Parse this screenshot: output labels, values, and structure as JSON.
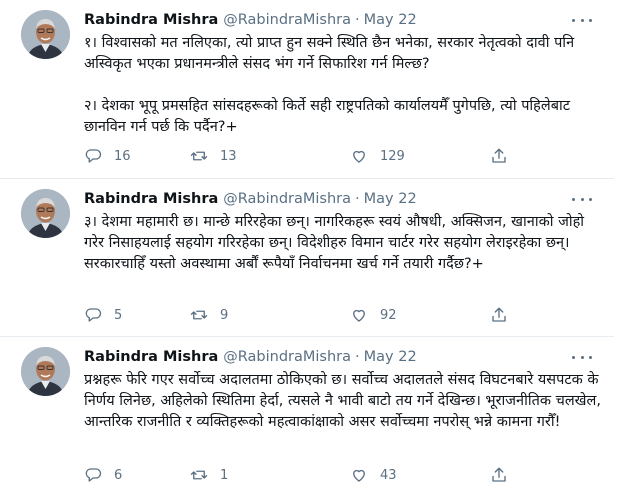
{
  "tweets": [
    {
      "author": "Rabindra Mishra",
      "handle": "@RabindraMishra",
      "separator": "·",
      "date": "May 22",
      "text": "१। विश्वासको मत नलिएका, त्यो प्राप्त हुन सक्ने स्थिति छैन भनेका, सरकार नेतृत्वको दावी पनि अस्विकृत भएका प्रधानमन्त्रीले संसद भंग गर्ने सिफारिश गर्न मिल्छ?\n\n२। देशका भूपू प्रमसहित सांसदहरूको किर्ते सही राष्ट्रपतिको कार्यालयमैँ पुगेपछि, त्यो पहिलेबाट छानविन गर्न पर्छ कि पर्दैन?+",
      "replies": "16",
      "retweets": "13",
      "likes": "129"
    },
    {
      "author": "Rabindra Mishra",
      "handle": "@RabindraMishra",
      "separator": "·",
      "date": "May 22",
      "text": "३। देशमा महामारी छ। मान्छे मरिरहेका छन्। नागरिकहरू स्वयं औषधी, अक्सिजन, खानाको जोहो गरेर निसाहयलाई सहयोग गरिरहेका छन्। विदेशीहरु विमान चार्टर गरेर सहयोग लेराइरहेका छन्। सरकारचाहिँ यस्तो अवस्थामा अर्बौं रूपैयाँ निर्वाचनमा खर्च गर्ने तयारी गर्दैछ?+",
      "replies": "5",
      "retweets": "9",
      "likes": "92"
    },
    {
      "author": "Rabindra Mishra",
      "handle": "@RabindraMishra",
      "separator": "·",
      "date": "May 22",
      "text": "प्रश्नहरू फेरि गएर सर्वोच्च अदालतमा ठोकिएको छ। सर्वोच्च अदालतले संसद विघटनबारे यसपटक के निर्णय लिनेछ, अहिलेको स्थितिमा हेर्दा, त्यसले नै भावी बाटो तय गर्ने देखिन्छ। भूराजनीतिक चलखेल, आन्तरिक राजनीति र व्यक्तिहरूको महत्वाकांक्षाको असर सर्वोच्चमा नपरोस् भन्ने कामना गरौँ!",
      "replies": "6",
      "retweets": "1",
      "likes": "43"
    }
  ],
  "colors": {
    "secondary_text": "#5b7083",
    "primary_text": "#0f1419",
    "divider": "#e6ecf0"
  },
  "icons": {
    "reply": "reply-icon",
    "retweet": "retweet-icon",
    "like": "heart-icon",
    "share": "share-icon",
    "more": "more-options-icon"
  }
}
